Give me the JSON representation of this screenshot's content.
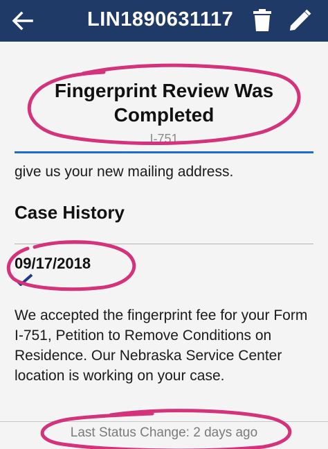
{
  "header": {
    "title": "LIN1890631117",
    "background": "#1f3a66",
    "icons": [
      "back-arrow-icon",
      "trash-icon",
      "pencil-icon"
    ]
  },
  "status": {
    "title": "Fingerprint Review Was Completed",
    "form_type": "I-751",
    "accent": "#1e6bd0"
  },
  "description_tail": "give us your new mailing address.",
  "case_history": {
    "title": "Case History",
    "entries": [
      {
        "date": "09/17/2018",
        "icon": "checkmark-icon",
        "text": "We accepted the fingerprint fee for your Form I-751, Petition to Remove Conditions on Residence. Our Nebraska Service Center location is working on your case."
      }
    ]
  },
  "footer": {
    "last_status_change": "Last Status Change: 2 days ago"
  },
  "annotation_color": "#d4327a"
}
